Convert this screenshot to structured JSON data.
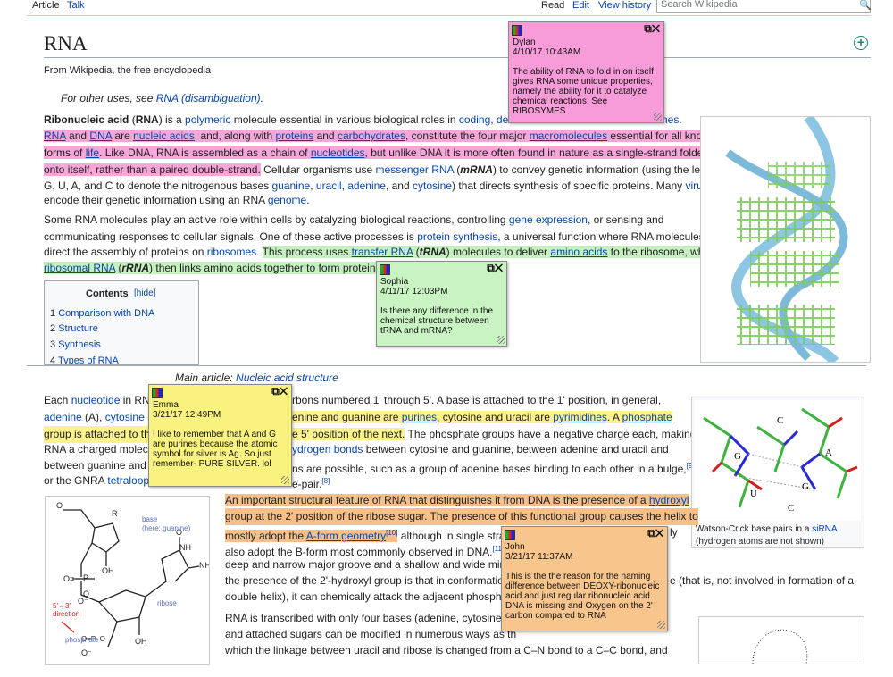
{
  "tabs": {
    "article": "Article",
    "talk": "Talk",
    "read": "Read",
    "edit": "Edit",
    "history": "View history"
  },
  "search": {
    "placeholder": "Search Wikipedia"
  },
  "title": "RNA",
  "tagline": "From Wikipedia, the free encyclopedia",
  "hatnote": {
    "prefix": "For other uses, see ",
    "link": "RNA (disambiguation)",
    "suffix": "."
  },
  "lead": {
    "l1": {
      "b1": "Ribonucleic acid",
      "t1": " (",
      "b2": "RNA",
      "t2": ") is a ",
      "a1": "polymeric",
      "t3": " molecule essential in various biological roles in ",
      "a2": "coding",
      "t4": ", ",
      "a3": "decodin",
      "tail": "nes."
    },
    "l2": {
      "a1": "RNA",
      "t1": " and ",
      "a2": "DNA",
      "t2": " are ",
      "a3": "nucleic acids",
      "t3": ", and, along with ",
      "a4": "proteins",
      "t4": " and ",
      "a5": "carbohydrates",
      "t5": ", constitute the four major ",
      "a6": "macromolecules",
      "t6": " essential for all known"
    },
    "l3": {
      "t1": "forms of ",
      "a1": "life",
      "t2": ". Like DNA, RNA is assembled as a chain of ",
      "a2": "nucleotides",
      "t3": ", but unlike DNA it is more often found in nature as a single-strand folded"
    },
    "l4": {
      "h": "onto itself, rather than a paired double-strand.",
      "t1": " Cellular organisms use ",
      "a1": "messenger RNA",
      "t2": " (",
      "b1": "mRNA",
      "t3": ") to convey genetic information (using the letters"
    },
    "l5": {
      "t1": "G, U, A, and C to denote the nitrogenous bases ",
      "a1": "guanine",
      "t2": ", ",
      "a2": "uracil",
      "t3": ", ",
      "a3": "adenine",
      "t4": ", and ",
      "a4": "cytosine",
      "t5": ") that directs synthesis of specific proteins. Many ",
      "a5": "viruses"
    },
    "l6": {
      "t1": "encode their genetic information using an RNA ",
      "a1": "genome",
      "t2": "."
    }
  },
  "para2": {
    "l1": {
      "t1": "Some RNA molecules play an active role within cells by catalyzing biological reactions, controlling ",
      "a1": "gene expression",
      "t2": ", or sensing and"
    },
    "l2": {
      "t1": "communicating responses to cellular signals. One of these active processes is ",
      "a1": "protein synthesis",
      "t2": ", a universal function where RNA molecules"
    },
    "l3": {
      "t1": "direct the assembly of proteins on ",
      "a1": "ribosomes",
      "t2": ". ",
      "h1": "This process uses ",
      "a2": "transfer RNA",
      "h2": " (",
      "b1": "tRNA",
      "h3": ") molecules to deliver ",
      "a3": "amino acids",
      "h4": " to the ribosome, where"
    },
    "l4": {
      "a1": "ribosomal RNA",
      "h1": " (",
      "b1": "rRNA",
      "h2": ") then links amino acids together to form proteins."
    }
  },
  "toc": {
    "title": "Contents",
    "hide": "[hide]",
    "items": [
      {
        "n": "1",
        "label": "Comparison with DNA"
      },
      {
        "n": "2",
        "label": "Structure"
      },
      {
        "n": "3",
        "label": "Synthesis"
      },
      {
        "n": "4",
        "label": "Types of RNA"
      }
    ]
  },
  "main_article": {
    "prefix": "Main article: ",
    "link": "Nucleic acid structure"
  },
  "structure": {
    "l1": {
      "t1": "Each ",
      "a1": "nucleotide",
      "t2": " in RNA",
      "t3": "rbons numbered 1' through 5'. A base is attached to the 1' position, in general,"
    },
    "l2": {
      "a1": "adenine",
      "t1": " (A), ",
      "a2": "cytosine",
      "t2": " (C",
      "h1": "enine and guanine are ",
      "a3": "purines",
      "h2": ", cytosine and uracil are ",
      "a4": "pyrimidines",
      "h3": ". A ",
      "a5": "phosphate"
    },
    "l3": {
      "h1": "group is attached to the",
      "h2": "e 5' position of the next.",
      "t1": " The phosphate groups have a negative charge each, making"
    },
    "l4": {
      "t1": "RNA a charged molecu",
      "a1": "ydrogen bonds",
      "t2": " between cytosine and guanine, between adenine and uracil and"
    },
    "l5": {
      "t1": "between guanine and u",
      "t2": "ns are possible, such as a group of adenine bases binding to each other in a bulge,",
      "s1": "[9]"
    },
    "l6": {
      "t1": "or the GNRA ",
      "a1": "tetraloop",
      "t2": "e-pair.",
      "s1": "[8]"
    }
  },
  "ribose": {
    "l1": "An important structural feature of RNA that distinguishes it from DNA is the presence of a ",
    "l1a": "hydroxyl",
    "l2": "group at the 2' position of the ribose sugar. The presence of this functional group causes the helix to",
    "l3": {
      "h1": "mostly adopt the ",
      "a1": "A-form geometry",
      "s1": "[10]",
      "t1": " although in single stran",
      "t2": "ly"
    },
    "l4": {
      "t1": "also adopt the B-form most commonly observed in DNA.",
      "s1": "[11]",
      "t2": " Th"
    },
    "l5": {
      "t1": "deep and narrow major groove and a shallow and wide minor"
    },
    "l6": {
      "t1": "the presence of the 2'-hydroxyl group is that in conformational",
      "t2": "e (that is, not involved in formation of a"
    },
    "l7": {
      "t1": "double helix), it can chemically attack the adjacent phosphodi"
    },
    "l8": {
      "t1": "RNA is transcribed with only four bases (adenine, cytosine, gu"
    },
    "l9": {
      "t1": "and attached sugars can be modified in numerous ways as th"
    },
    "l10": {
      "t1": "which the linkage between uracil and ribose is changed from a C–N bond to a C–C bond, and"
    }
  },
  "figure1": {
    "caption1": "Watson-Crick base pairs in a ",
    "caption1a": "siRNA",
    "caption2": "(hydrogen atoms are not shown)"
  },
  "figure2": {
    "base": "base",
    "base2": "(here: guanine)",
    "ribose": "ribose",
    "phosphate": "phosphate",
    "dir1": "5'→3'",
    "dir2": "direction"
  },
  "notes": [
    {
      "user": "Dylan",
      "date": "4/10/17 10:43AM",
      "text": "The ability of RNA to fold in on itself gives RNA some unique properties, namely the ability for it to catalyze chemical reactions. See RIBOSYMES",
      "color": "#f79cd9"
    },
    {
      "user": "Sophia",
      "date": "4/11/17 12:03PM",
      "text": "Is there any difference in the chemical structure between tRNA and mRNA?",
      "color": "#c9f3c2"
    },
    {
      "user": "Emma",
      "date": "3/21/17 12:49PM",
      "text": "I like to remember that A and G are purines because the atomic symbol for silver is Ag. So just remember- PURE SILVER. lol",
      "color": "#faf27e"
    },
    {
      "user": "John",
      "date": "3/21/17 11:37AM",
      "text": "This is the the reason for the naming difference between DEOXY-ribonucleic acid and just regular ribonucleic acid. DNA is missing and Oxygen on the 2' carbon compared to RNA",
      "color": "#f8c58d"
    }
  ],
  "note_controls": "⧉✕"
}
